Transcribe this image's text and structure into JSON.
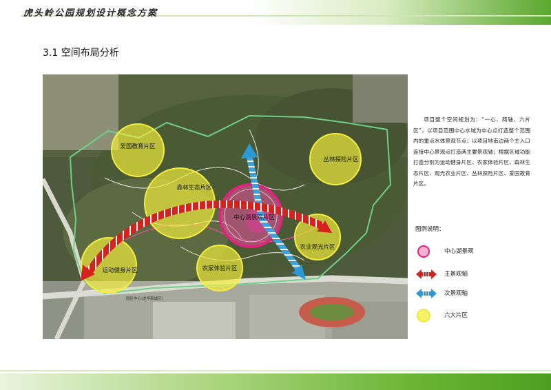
{
  "header": {
    "title": "虎头岭公园规划设计概念方案"
  },
  "section": {
    "title": "3.1 空间布局分析"
  },
  "map": {
    "zones": [
      {
        "name": "爱国教育片区"
      },
      {
        "name": "森林生态片区"
      },
      {
        "name": "丛林探险片区"
      },
      {
        "name": "运动健身片区"
      },
      {
        "name": "农家体验片区"
      },
      {
        "name": "农业观光片区"
      },
      {
        "name": "中心湖景观片区"
      }
    ],
    "street_label": "园区中心(龙华新城区)"
  },
  "description": "项目整个空间规划为：“一心、两轴、六片区”，以项目范围中心水域为中心点打造整个范围内的重点水体景观节点；以项目地南边两个主入口连接中心景观点打造两主要景观轴；根据区域功能打造分别为运动健身片区、农家体验片区、森林生态片区、观光农业片区、丛林探险片区、爱国教育片区。",
  "legend": {
    "title": "图例说明：",
    "items": [
      {
        "label": "中心湖景观",
        "icon": "pink-circle-icon",
        "color": "#e8509c"
      },
      {
        "label": "主景观轴",
        "icon": "red-double-arrow-icon",
        "color": "#d8211c"
      },
      {
        "label": "次景观轴",
        "icon": "blue-double-arrow-icon",
        "color": "#2a9ad6"
      },
      {
        "label": "六大片区",
        "icon": "yellow-circle-icon",
        "color": "#f5ef3c"
      }
    ]
  }
}
